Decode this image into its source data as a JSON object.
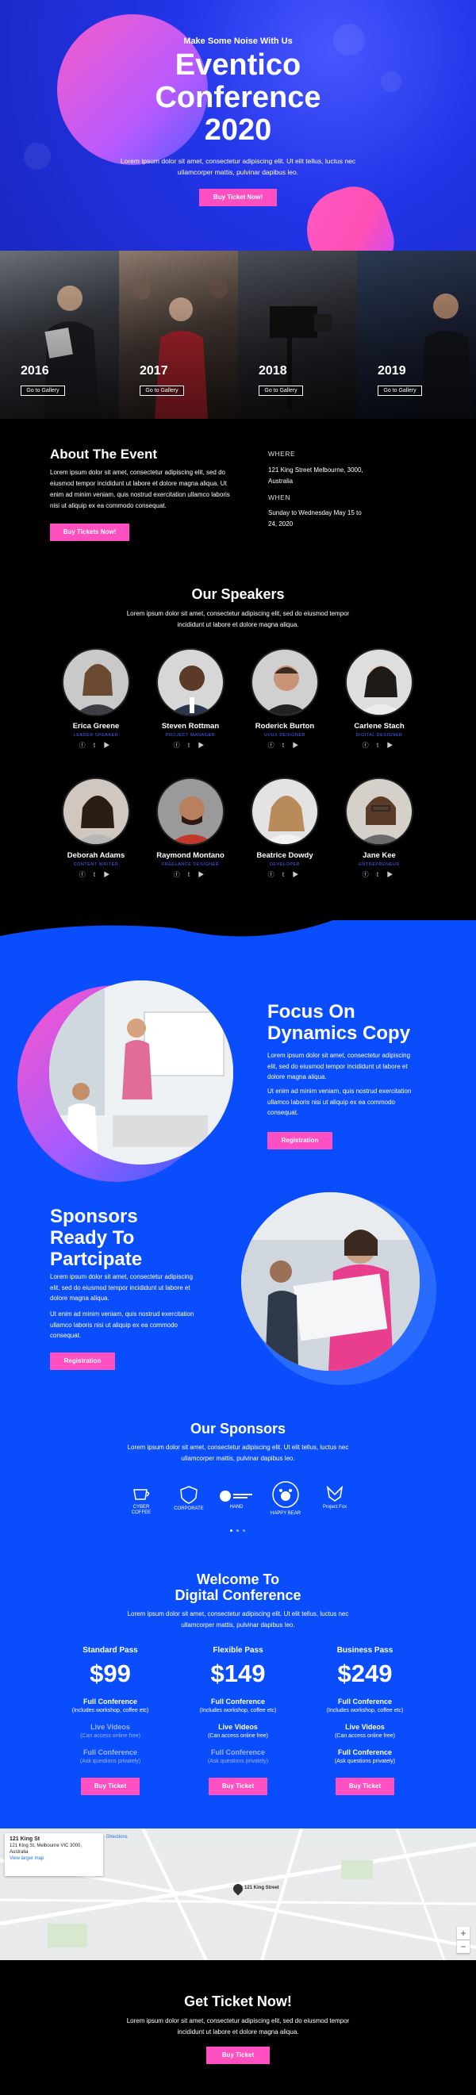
{
  "hero": {
    "kicker": "Make Some Noise With Us",
    "title_lines": [
      "Eventico",
      "Conference",
      "2020"
    ],
    "text": "Lorem ipsum dolor sit amet, consectetur adipiscing elit. Ut elit tellus, luctus nec ullamcorper mattis, pulvinar dapibus leo.",
    "button": "Buy Ticket Now!"
  },
  "gallery": [
    {
      "year": "2016",
      "button": "Go to Gallery"
    },
    {
      "year": "2017",
      "button": "Go to Gallery"
    },
    {
      "year": "2018",
      "button": "Go to Gallery"
    },
    {
      "year": "2019",
      "button": "Go to Gallery"
    }
  ],
  "about": {
    "title": "About The Event",
    "text": "Lorem ipsum dolor sit amet, consectetur adipiscing elit, sed do eiusmod tempor incididunt ut labore et dolore magna aliqua. Ut enim ad minim veniam, quis nostrud exercitation ullamco laboris nisi ut aliquip ex ea commodo consequat.",
    "button": "Buy Tickets Now!",
    "where_label": "WHERE",
    "where_value": "121 King Street Melbourne, 3000, Australia",
    "when_label": "WHEN",
    "when_value": "Sunday to Wednesday May 15 to 24, 2020"
  },
  "speakers": {
    "title": "Our Speakers",
    "text": "Lorem ipsum dolor sit amet, consectetur adipiscing elit, sed do eiusmod tempor incididunt ut labore et dolore magna aliqua.",
    "items": [
      {
        "name": "Erica Greene",
        "role": "LEADER SPEAKER"
      },
      {
        "name": "Steven Rottman",
        "role": "PROJECT MANAGER"
      },
      {
        "name": "Roderick Burton",
        "role": "UI/UX DESIGNER"
      },
      {
        "name": "Carlene Stach",
        "role": "DIGITAL DESIGNER"
      },
      {
        "name": "Deborah Adams",
        "role": "CONTENT WRITER"
      },
      {
        "name": "Raymond Montano",
        "role": "FREELANCE DESIGNER"
      },
      {
        "name": "Beatrice Dowdy",
        "role": "DEVELOPER"
      },
      {
        "name": "Jane Kee",
        "role": "ENTREPRENEUR"
      }
    ]
  },
  "focus": {
    "title_lines": [
      "Focus On",
      "Dynamics Copy"
    ],
    "text1": "Lorem ipsum dolor sit amet, consectetur adipiscing elit, sed do eiusmod tempor incididunt ut labore et dolore magna aliqua.",
    "text2": "Ut enim ad minim veniam, quis nostrud exercitation ullamco laboris nisi ut aliquip ex ea commodo consequat.",
    "button": "Registration"
  },
  "sponsors_ready": {
    "title_lines": [
      "Sponsors",
      "Ready To",
      "Partcipate"
    ],
    "text1": "Lorem ipsum dolor sit amet, consectetur adipiscing elit, sed do eiusmod tempor incididunt ut labore et dolore magna aliqua.",
    "text2": "Ut enim ad minim veniam, quis nostrud exercitation ullamco laboris nisi ut aliquip ex ea commodo consequat.",
    "button": "Registration"
  },
  "our_sponsors": {
    "title": "Our Sponsors",
    "text": "Lorem ipsum dolor sit amet, consectetur adipiscing elit. Ut elit tellus, luctus nec ullamcorper mattis, pulvinar dapibus leo.",
    "logos": [
      {
        "label": "CYBER COFFEE"
      },
      {
        "label": "CORPORATE"
      },
      {
        "label": "HAND"
      },
      {
        "label": "HAPPY BEAR"
      },
      {
        "label": "Project Fox"
      }
    ]
  },
  "pricing": {
    "title_lines": [
      "Welcome To",
      "Digital Conference"
    ],
    "text": "Lorem ipsum dolor sit amet, consectetur adipiscing elit. Ut elit tellus, luctus nec ullamcorper mattis, pulvinar dapibus leo.",
    "plans": [
      {
        "name": "Standard Pass",
        "price": "$99",
        "f1": "Full Conference",
        "f1d": "(Includes workshop, coffee etc)",
        "f2": "Live Videos",
        "f2d": "(Can access online free)",
        "f3": "Full Conference",
        "f3d": "(Ask questions privately)",
        "button": "Buy Ticket"
      },
      {
        "name": "Flexible Pass",
        "price": "$149",
        "f1": "Full Conference",
        "f1d": "(Includes workshop, coffee etc)",
        "f2": "Live Videos",
        "f2d": "(Can access online free)",
        "f3": "Full Conference",
        "f3d": "(Ask questions privately)",
        "button": "Buy Ticket"
      },
      {
        "name": "Business Pass",
        "price": "$249",
        "f1": "Full Conference",
        "f1d": "(Includes workshop, coffee etc)",
        "f2": "Live Videos",
        "f2d": "(Can access online free)",
        "f3": "Full Conference",
        "f3d": "(Ask questions privately)",
        "button": "Buy Ticket"
      }
    ]
  },
  "map": {
    "card_title": "121 King St",
    "card_address": "121 King St, Melbourne VIC 3000, Australia",
    "card_link": "View larger map",
    "directions": "Directions",
    "pin_label": "121 King Street",
    "zoom_in": "+",
    "zoom_out": "−"
  },
  "cta": {
    "title": "Get Ticket Now!",
    "text": "Lorem ipsum dolor sit amet, consectetur adipiscing elit, sed do eiusmod tempor incididunt ut labore et dolore magna aliqua.",
    "button": "Buy Ticket"
  },
  "colors": {
    "accent": "#ff4fc0",
    "blue": "#0a4dfc",
    "dark": "#000000"
  }
}
